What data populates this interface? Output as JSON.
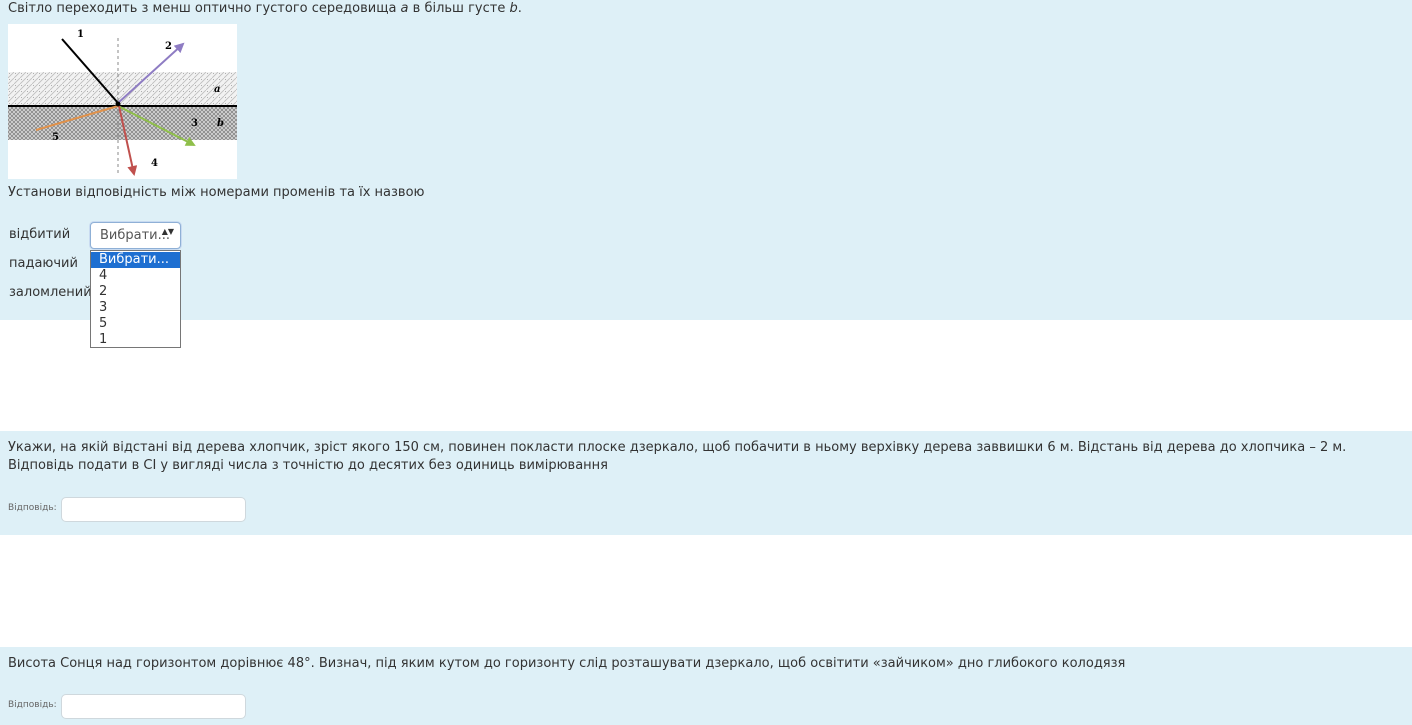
{
  "question1": {
    "text_before_a": "Світло переходить з менш оптично густого середовища ",
    "medium_a": "a",
    "text_middle": " в більш густе ",
    "medium_b": "b",
    "text_end": ".",
    "figure_labels": [
      "1",
      "2",
      "a",
      "3",
      "b",
      "5",
      "4"
    ],
    "instruction": "Установи відповідність між номерами променів та їх назвою",
    "rows": [
      "відбитий",
      "падаючий",
      "заломлений"
    ],
    "select_value": "Вибрати...",
    "select_arrows": "▲▼",
    "dropdown_options": [
      "Вибрати...",
      "4",
      "2",
      "3",
      "5",
      "1"
    ]
  },
  "question2": {
    "text": "Укажи, на якій відстані від дерева хлопчик, зріст якого 150 см, повинен покласти плоске дзеркало, щоб побачити в ньому верхівку дерева заввишки 6 м. Відстань від дерева до хлопчика – 2 м. Відповідь подати в СІ у вигляді числа з точністю до десятих без одиниць вимірювання",
    "answer_label": "Відповідь:",
    "answer_value": ""
  },
  "question3": {
    "text": "Висота Сонця над горизонтом дорівнює 48°. Визнач, під яким кутом до горизонту слід розташувати дзеркало, щоб освітити «зайчиком» дно глибокого колодязя",
    "answer_label": "Відповідь:",
    "answer_value": ""
  },
  "colors": {
    "question_bg": "#def0f7",
    "selected_option_bg": "#1e6fd1",
    "ray_reflected": "#8e7cc3",
    "ray_refracted_3": "#8fbf4a",
    "ray_refracted_4": "#c0504d",
    "ray_5": "#e0914a"
  }
}
